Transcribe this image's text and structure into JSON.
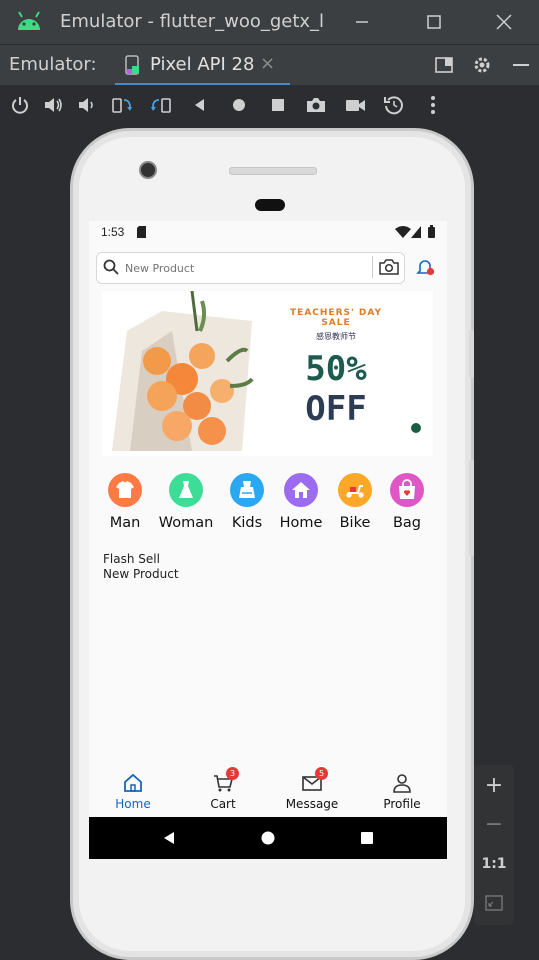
{
  "window": {
    "title": "Emulator - flutter_woo_getx_le"
  },
  "tabbar": {
    "label": "Emulator:",
    "tab_name": "Pixel API 28",
    "close_glyph": "×"
  },
  "zoom": {
    "plus": "+",
    "minus": "−",
    "one_to_one": "1:1"
  },
  "app": {
    "status_time": "1:53",
    "search_placeholder": "New Product",
    "banner": {
      "subtitle": "TEACHERS' DAY SALE",
      "chinese": "感恩教师节",
      "percent": "50%",
      "off": "OFF"
    },
    "categories": [
      {
        "label": "Man",
        "color": "#ff7a45",
        "icon": "shirt-icon"
      },
      {
        "label": "Woman",
        "color": "#3ddc97",
        "icon": "dress-icon"
      },
      {
        "label": "Kids",
        "color": "#2aa8f2",
        "icon": "kids-dress-icon"
      },
      {
        "label": "Home",
        "color": "#9b6bf2",
        "icon": "house-icon"
      },
      {
        "label": "Bike",
        "color": "#ffa726",
        "icon": "scooter-icon"
      },
      {
        "label": "Bag",
        "color": "#e056c6",
        "icon": "bag-icon"
      }
    ],
    "sections": {
      "flash": "Flash Sell",
      "new_product": "New Product"
    },
    "bottom_nav": [
      {
        "label": "Home",
        "icon": "home-icon",
        "active": true,
        "badge": null
      },
      {
        "label": "Cart",
        "icon": "cart-icon",
        "active": false,
        "badge": "3"
      },
      {
        "label": "Message",
        "icon": "mail-icon",
        "active": false,
        "badge": "5"
      },
      {
        "label": "Profile",
        "icon": "user-icon",
        "active": false,
        "badge": null
      }
    ],
    "active_color": "#1565c0",
    "badge_color": "#e53935"
  }
}
